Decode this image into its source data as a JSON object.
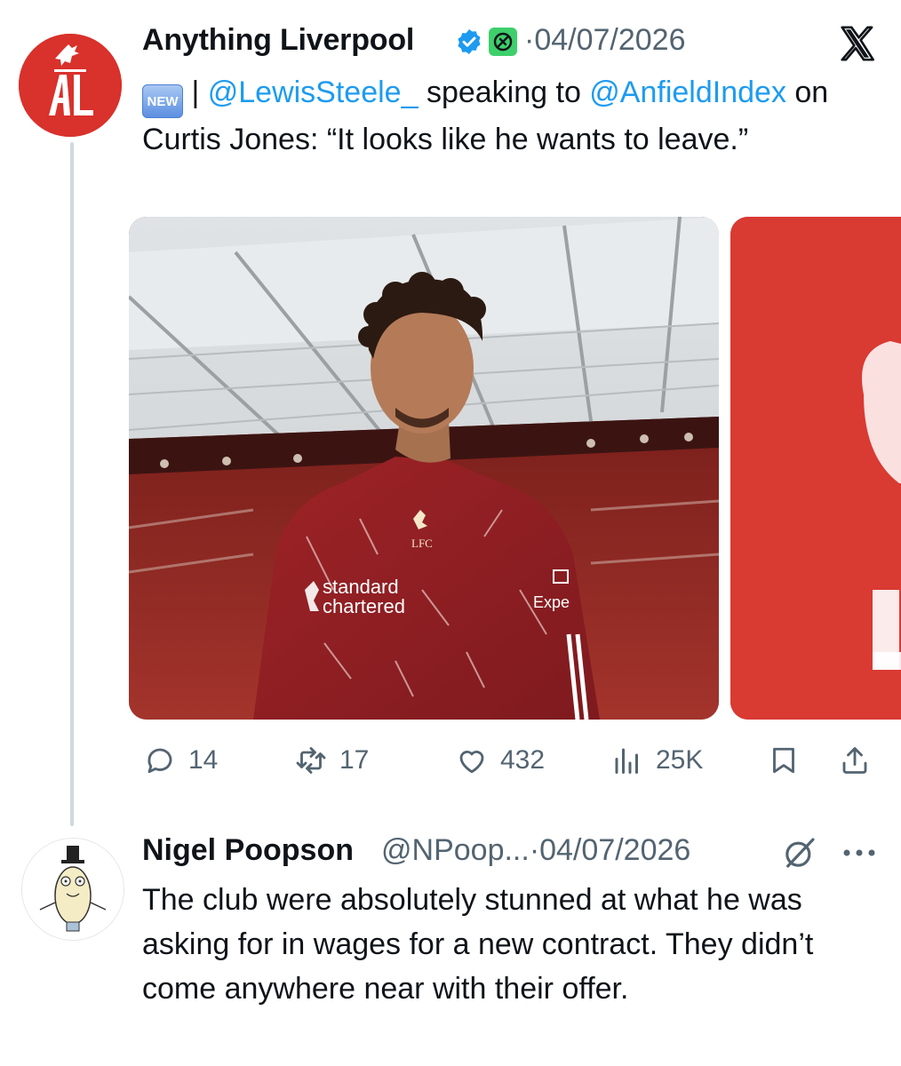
{
  "tweet": {
    "author_name": "Anything Liverpool",
    "date": "04/07/2026",
    "badge": "NEW",
    "text_parts": {
      "separator": " | ",
      "mention1": "@LewisSteele_",
      "middle": " speaking to ",
      "mention2": "@AnfieldIndex",
      "rest": " on Curtis Jones: “It looks like he wants to leave.”"
    },
    "stats": {
      "replies": "14",
      "reposts": "17",
      "likes": "432",
      "views": "25K"
    }
  },
  "reply": {
    "author_name": "Nigel Poopson",
    "handle": "@NPoop...",
    "date": "04/07/2026",
    "text": "The club were absolutely stunned at what he was asking for in wages for a new contract. They didn’t come anywhere near with their offer."
  },
  "image": {
    "sponsor_line1": "standard",
    "sponsor_line2": "chartered",
    "crest_text": "LFC",
    "sleeve_text": "Expe"
  },
  "icons": {
    "verified": "verified-check-icon",
    "affiliate": "affiliate-badge-icon",
    "platform": "x-logo-icon",
    "reply": "reply-bubble-icon",
    "repost": "repost-icon",
    "like": "heart-icon",
    "views": "views-bar-icon",
    "bookmark": "bookmark-icon",
    "share": "share-icon",
    "grok": "grok-icon",
    "more": "more-dots-icon"
  },
  "colors": {
    "link": "#1d9bf0",
    "muted": "#536471",
    "avatar_red": "#d9312b",
    "thread_line": "#cfd9de"
  }
}
